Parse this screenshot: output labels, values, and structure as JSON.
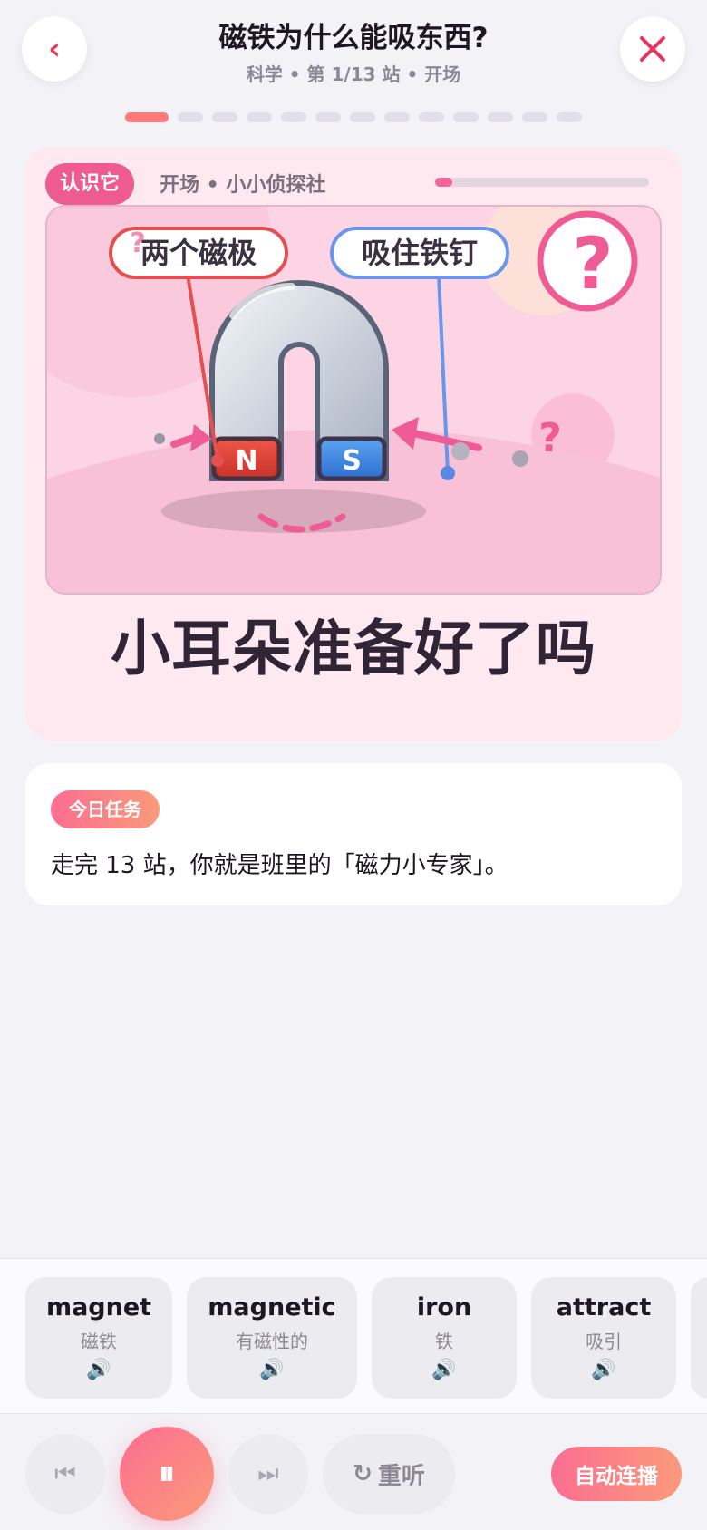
{
  "header": {
    "title": "磁铁为什么能吸东西?",
    "subtitle": "科学 • 第 1/13 站 • 开场",
    "back_icon": "‹"
  },
  "progress_dots": {
    "total": 13,
    "current": 1
  },
  "card": {
    "tag": "认识它",
    "stage_title": "开场 • 小小侦探社",
    "stage_progress": 0.08,
    "illustration": {
      "label_left": "两个磁极",
      "label_right": "吸住铁钉",
      "pole_n": "N",
      "pole_s": "S",
      "question_mark": "?"
    },
    "headline": "小耳朵准备好了吗"
  },
  "task": {
    "badge": "今日任务",
    "text": "走完 13 站，你就是班里的「磁力小专家」。"
  },
  "vocab": [
    {
      "word": "magnet",
      "translation": "磁铁",
      "icon": "speaker-icon"
    },
    {
      "word": "magnetic",
      "translation": "有磁性的",
      "icon": "speaker-icon"
    },
    {
      "word": "iron",
      "translation": "铁",
      "icon": "speaker-icon"
    },
    {
      "word": "attract",
      "translation": "吸引",
      "icon": "speaker-icon"
    }
  ],
  "controls": {
    "prev_icon": "⏮",
    "pause_icon": "⏸",
    "next_icon": "⏭",
    "replay_icon": "↻",
    "replay_label": "重听",
    "auto_label": "自动连播"
  },
  "colors": {
    "accent": "#ee5b8f",
    "close": "#e8345b",
    "background": "#f3f2f7",
    "card_bg": "#ffe9f1"
  }
}
